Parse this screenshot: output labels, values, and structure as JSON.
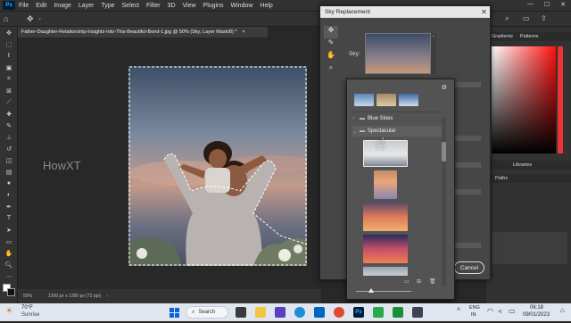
{
  "menubar": {
    "app_icon": "Ps",
    "items": [
      "File",
      "Edit",
      "Image",
      "Layer",
      "Type",
      "Select",
      "Filter",
      "3D",
      "View",
      "Plugins",
      "Window",
      "Help"
    ]
  },
  "document": {
    "tab_title": "Father-Daughter-Relationship-Insights-Into-This-Beautiful-Bond-1.jpg @ 50% (Sky, Layer Mask/8) *",
    "close": "×",
    "zoom": "50%",
    "dimensions": "1200 px x 1350 px (72 ppi)"
  },
  "watermark": "HowXT",
  "dialog": {
    "title": "Sky Replacement",
    "close": "✕",
    "sky_label": "Sky:",
    "cancel_label": "Cancel",
    "tools": [
      "move-icon",
      "brush-icon",
      "hand-icon",
      "zoom-icon"
    ]
  },
  "sky_picker": {
    "folders": [
      {
        "name": "Blue Skies",
        "expanded": false
      },
      {
        "name": "Spectacular",
        "expanded": true
      }
    ],
    "gear": "⚙"
  },
  "right_panel": {
    "tabs_top": [
      "Gradients",
      "Patterns"
    ],
    "tabs_mid": [
      "Libraries"
    ],
    "tabs_low": [
      "Paths"
    ]
  },
  "taskbar": {
    "weather_temp": "70°F",
    "weather_desc": "Sunrise",
    "search_label": "Search",
    "lang_top": "ENG",
    "lang_bottom": "IN",
    "time": "06:18",
    "date": "09/01/2023"
  },
  "colors": {
    "accent": "#31a8ff",
    "dialog_bg": "#464646",
    "popup_bg": "#535353"
  }
}
